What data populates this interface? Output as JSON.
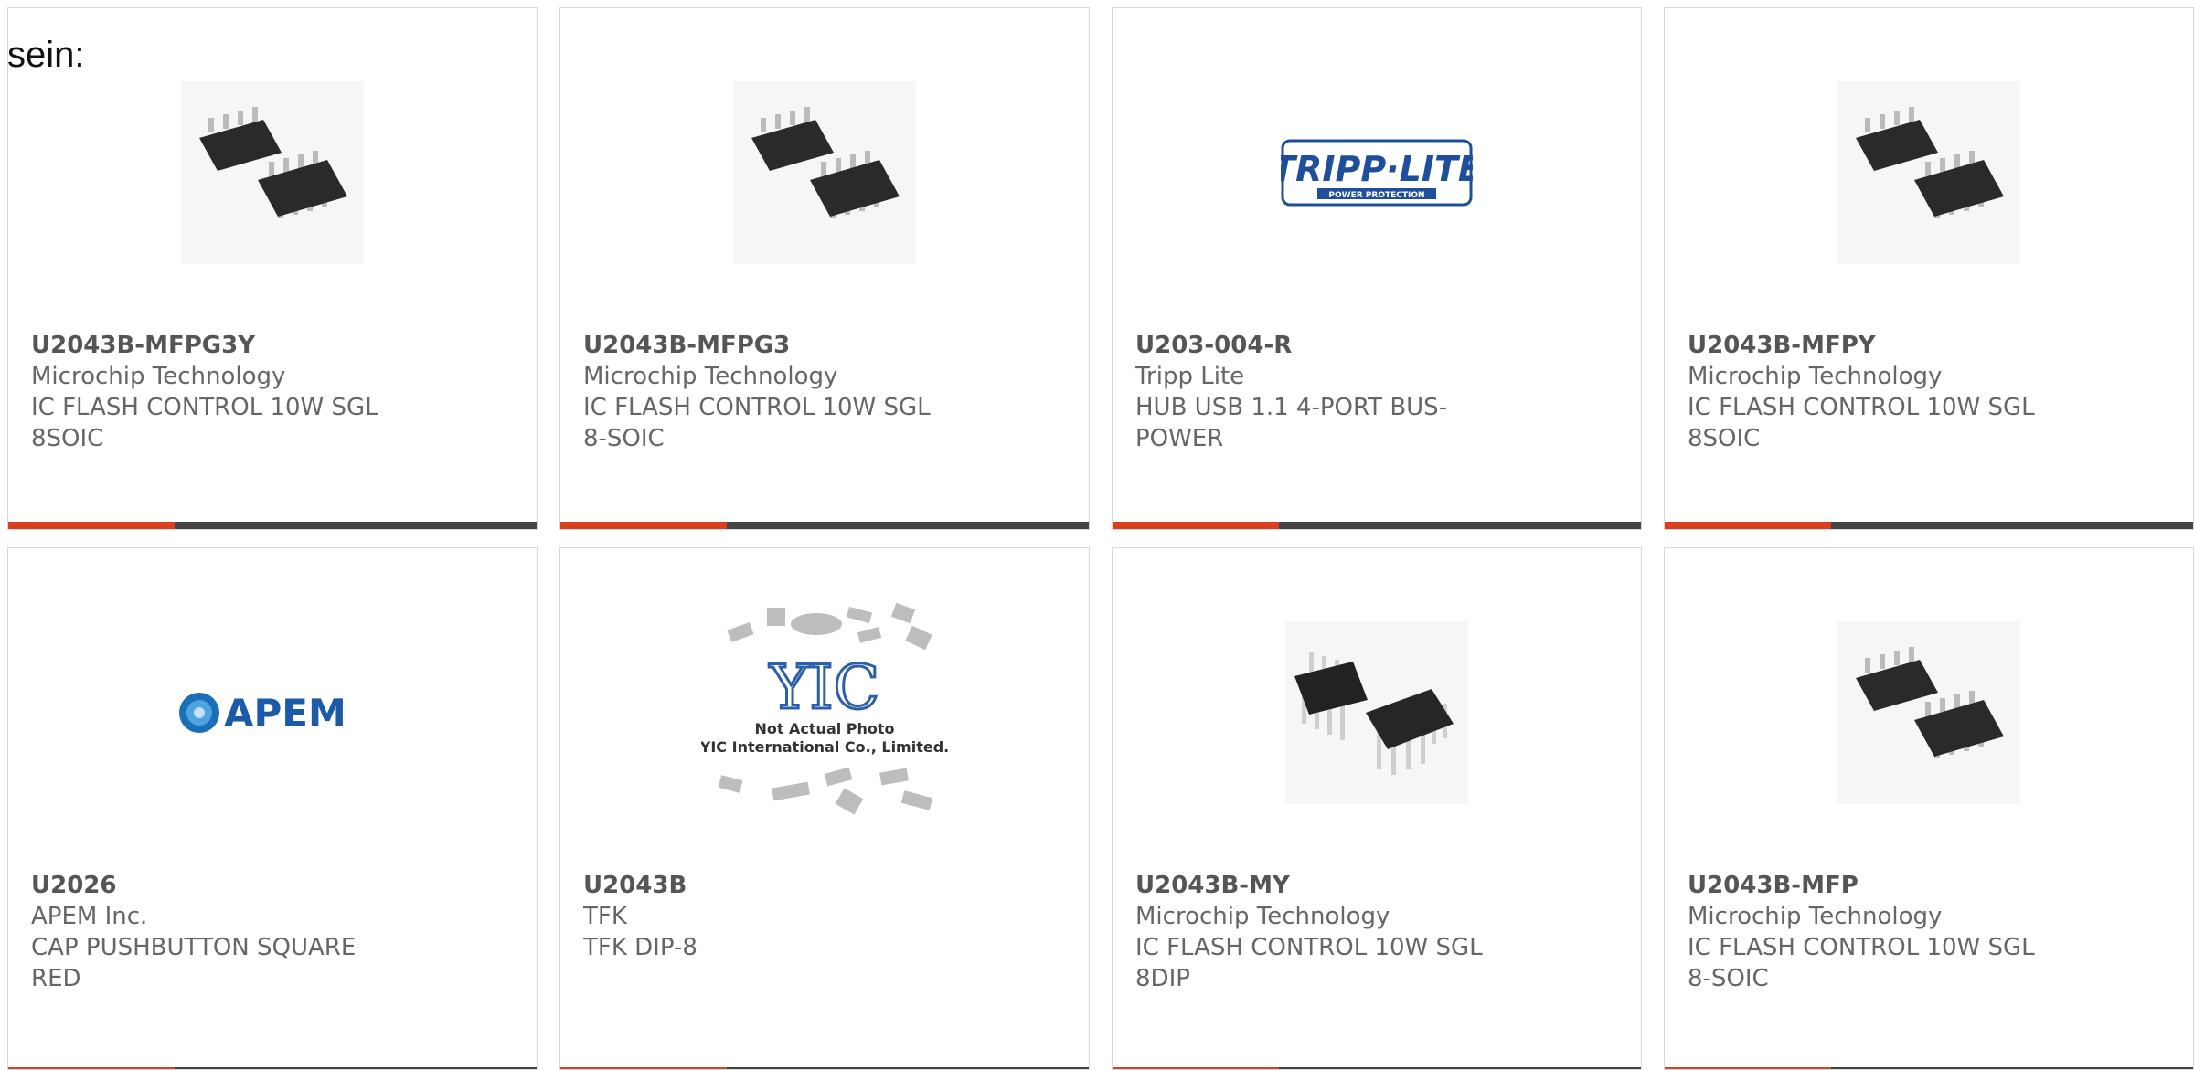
{
  "intro_text": "sein:",
  "colors": {
    "accent": "#d9401c",
    "bar": "#444444",
    "border": "#d8d8d8",
    "text": "#666666"
  },
  "cards": [
    {
      "part": "U2043B-MFPG3Y",
      "maker": "Microchip Technology",
      "desc": "IC FLASH CONTROL 10W SGL 8SOIC",
      "image": "soic-chip"
    },
    {
      "part": "U2043B-MFPG3",
      "maker": "Microchip Technology",
      "desc": "IC FLASH CONTROL 10W SGL 8-SOIC",
      "image": "soic-chip"
    },
    {
      "part": "U203-004-R",
      "maker": "Tripp Lite",
      "desc": "HUB USB 1.1 4-PORT BUS-POWER",
      "image": "tripp-lite-logo",
      "logo_text": "TRIPP·LITE",
      "logo_sub": "POWER PROTECTION"
    },
    {
      "part": "U2043B-MFPY",
      "maker": "Microchip Technology",
      "desc": "IC FLASH CONTROL 10W SGL 8SOIC",
      "image": "soic-chip"
    },
    {
      "part": "U2026",
      "maker": "APEM Inc.",
      "desc": "CAP PUSHBUTTON SQUARE RED",
      "image": "apem-logo",
      "logo_text": "APEM"
    },
    {
      "part": "U2043B",
      "maker": "TFK",
      "desc": "TFK DIP-8",
      "image": "placeholder",
      "logo_text": "YIC",
      "note1": "Not Actual Photo",
      "note2": "YIC International Co., Limited."
    },
    {
      "part": "U2043B-MY",
      "maker": "Microchip Technology",
      "desc": "IC FLASH CONTROL 10W SGL 8DIP",
      "image": "dip-chip"
    },
    {
      "part": "U2043B-MFP",
      "maker": "Microchip Technology",
      "desc": "IC FLASH CONTROL 10W SGL 8-SOIC",
      "image": "soic-chip"
    }
  ]
}
